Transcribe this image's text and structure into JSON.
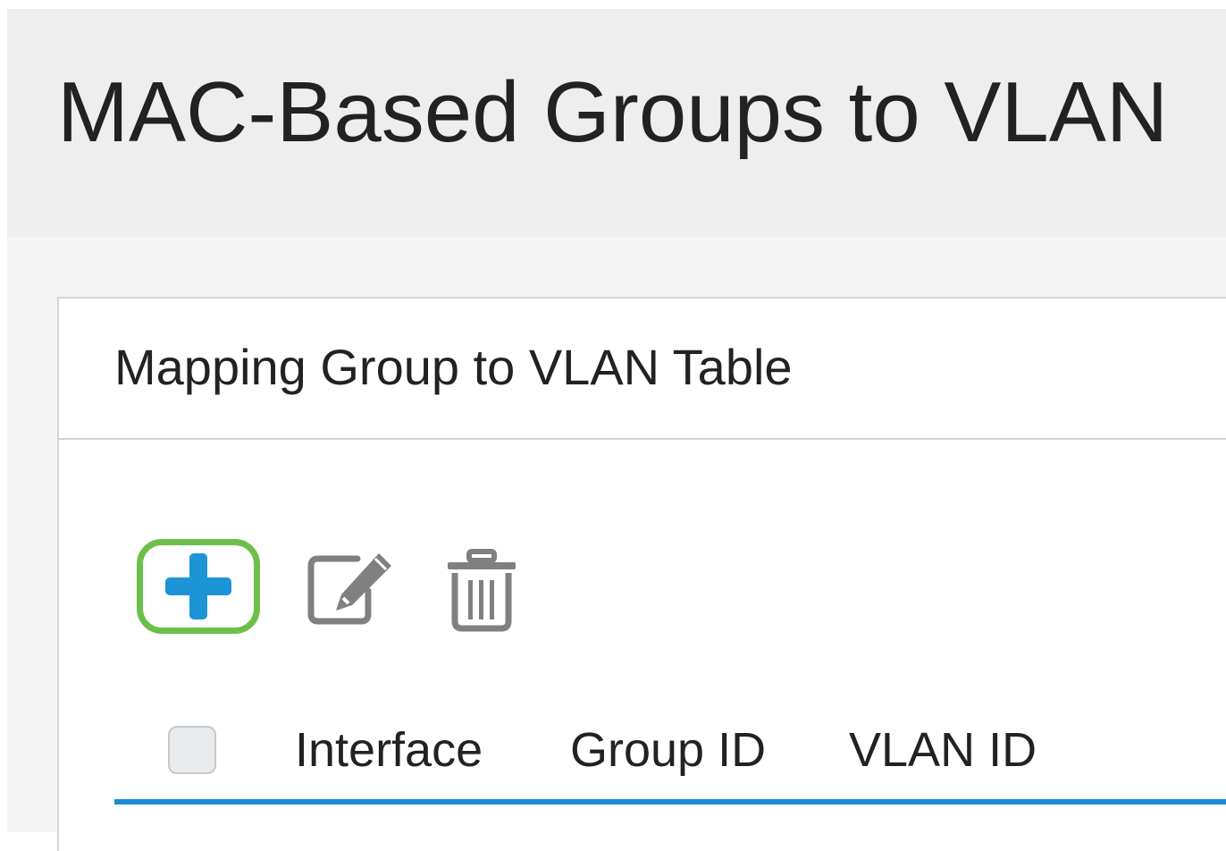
{
  "page": {
    "title": "MAC-Based Groups to VLAN"
  },
  "panel": {
    "title": "Mapping Group to VLAN Table"
  },
  "toolbar": {
    "add_icon": "plus-icon",
    "edit_icon": "edit-icon",
    "delete_icon": "trash-icon",
    "colors": {
      "add_plus": "#1d94d6",
      "add_highlight": "#6cc04a",
      "icon_gray": "#808080"
    }
  },
  "table": {
    "columns": [
      "Interface",
      "Group ID",
      "VLAN ID"
    ],
    "header_underline_color": "#1a8ed6"
  }
}
